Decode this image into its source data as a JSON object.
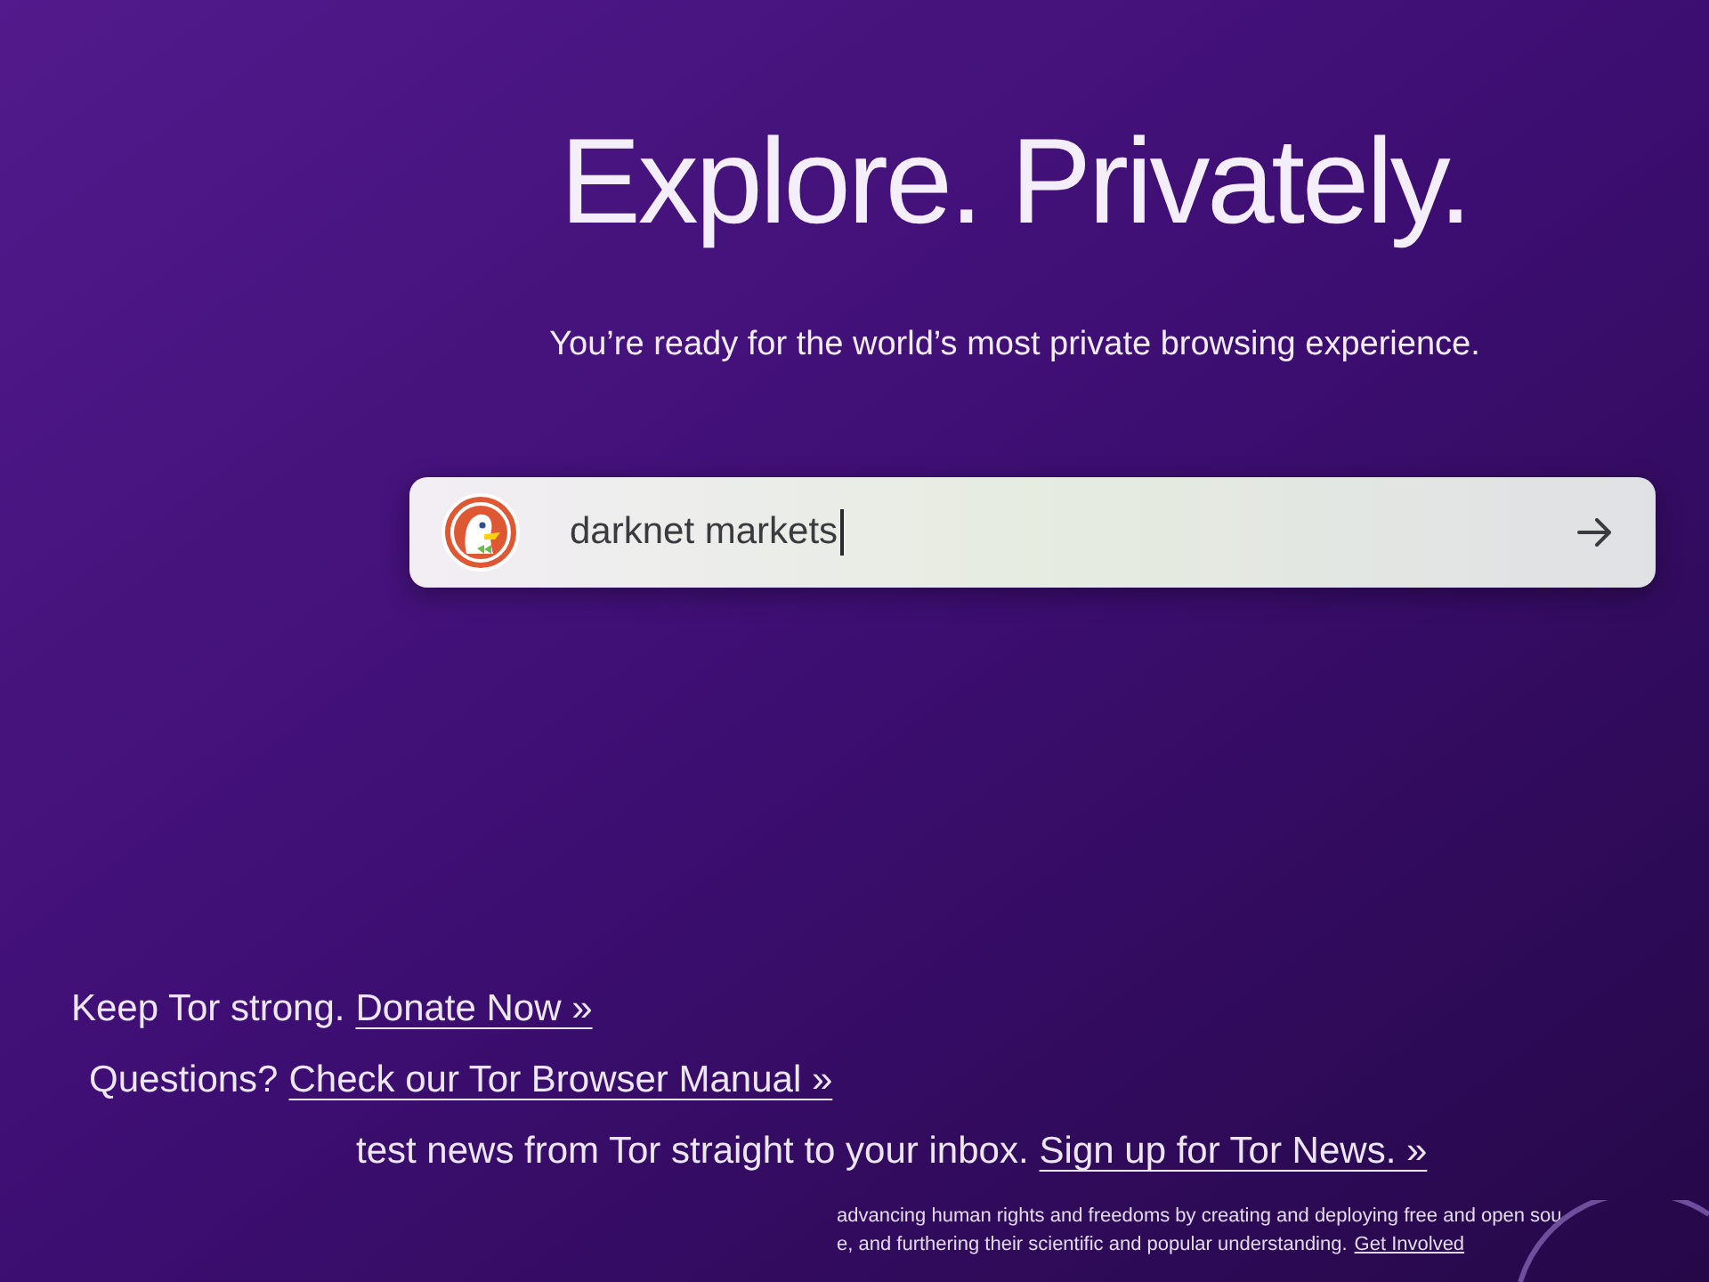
{
  "heading": "Explore. Privately.",
  "subheading": "You’re ready for the world’s most private browsing experience.",
  "search": {
    "value": "darknet markets",
    "focused": true
  },
  "promos": [
    {
      "text": "Keep Tor strong.",
      "link": "Donate Now »"
    },
    {
      "text": "Questions?",
      "link": "Check our Tor Browser Manual »"
    },
    {
      "text": "test news from Tor straight to your inbox.",
      "link": "Sign up for Tor News. »"
    }
  ],
  "mission": {
    "lines": [
      "advancing human rights and freedoms by creating and deploying free and open sou",
      "e, and furthering their scientific and popular understanding."
    ],
    "link": "Get Involved"
  }
}
